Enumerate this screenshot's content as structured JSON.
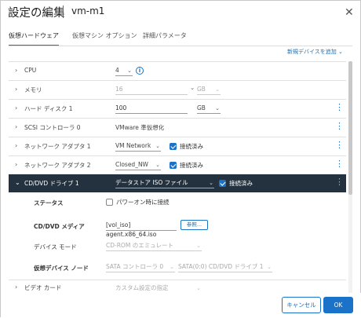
{
  "dialog": {
    "title": "設定の編集",
    "vm_name": "vm-m1",
    "close_glyph": "✕"
  },
  "tabs": [
    {
      "label": "仮想ハードウェア",
      "active": true
    },
    {
      "label": "仮想マシン オプション",
      "active": false
    },
    {
      "label": "詳細パラメータ",
      "active": false
    }
  ],
  "add_device_label": "新規デバイスを追加 ⌄",
  "rows": {
    "cpu": {
      "label": "CPU",
      "value": "4"
    },
    "memory": {
      "label": "メモリ",
      "value": "16",
      "unit": "GB"
    },
    "hdd": {
      "label": "ハード ディスク 1",
      "value": "100",
      "unit": "GB"
    },
    "scsi": {
      "label": "SCSI コントローラ 0",
      "value": "VMware 準仮想化"
    },
    "nic1": {
      "label": "ネットワーク アダプタ 1",
      "value": "VM Network",
      "connected_label": "接続済み",
      "connected": true
    },
    "nic2": {
      "label": "ネットワーク アダプタ 2",
      "value": "Closed_NW",
      "connected_label": "接続済み",
      "connected": true
    },
    "cdrom": {
      "label": "CD/DVD ドライブ 1",
      "value": "データストア ISO ファイル",
      "connected_label": "接続済み",
      "connected": true
    },
    "video": {
      "label": "ビデオ カード",
      "value": "カスタム設定の指定"
    }
  },
  "cdrom_detail": {
    "status_label": "ステータス",
    "power_on_label": "パワーオン時に接続",
    "power_on_checked": false,
    "media_label": "CD/DVD メディア",
    "media_value": "[vol_iso] agent.x86_64.iso",
    "browse_label": "参照...",
    "device_mode_label": "デバイス モード",
    "device_mode_value": "CD-ROM のエミュレート",
    "node_label": "仮想デバイス ノード",
    "node_controller": "SATA コントローラ 0",
    "node_slot": "SATA(0:0) CD/DVD ドライブ 1"
  },
  "icons": {
    "chevron_right": "›",
    "chevron_down": "⌄",
    "dropdown": "⌄",
    "kebab": "⋮",
    "info": "i"
  },
  "footer": {
    "cancel_label": "キャンセル",
    "ok_label": "OK"
  },
  "colors": {
    "accent": "#1a73c8",
    "selected_row_bg": "#23323e"
  }
}
